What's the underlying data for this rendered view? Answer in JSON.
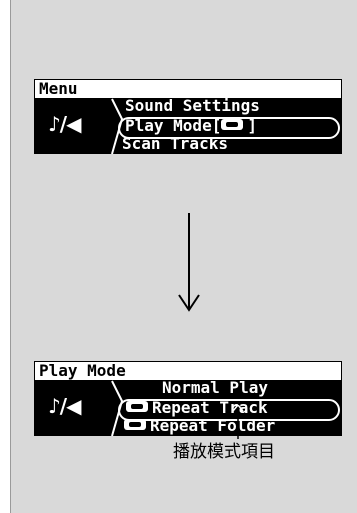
{
  "menu_screen": {
    "title": "Menu",
    "icon": "music-note-icon",
    "items": [
      {
        "label": "Sound Settings"
      },
      {
        "label": "Play Mode[",
        "suffix": "]",
        "has_icon": true,
        "selected": true
      },
      {
        "label": "Scan Tracks"
      }
    ]
  },
  "play_mode_screen": {
    "title": "Play Mode",
    "icon": "music-note-icon",
    "items": [
      {
        "label": "Normal Play"
      },
      {
        "label": "Repeat Track",
        "has_icon": true,
        "selected": true
      },
      {
        "label": "Repeat Folder",
        "has_icon": true
      }
    ]
  },
  "transition": {
    "icon": "down-arrow-icon"
  },
  "callout": {
    "label": "播放模式項目"
  },
  "colors": {
    "panel_bg": "#d9d9d9",
    "lcd_bg": "#000000",
    "lcd_text": "#ffffff"
  }
}
